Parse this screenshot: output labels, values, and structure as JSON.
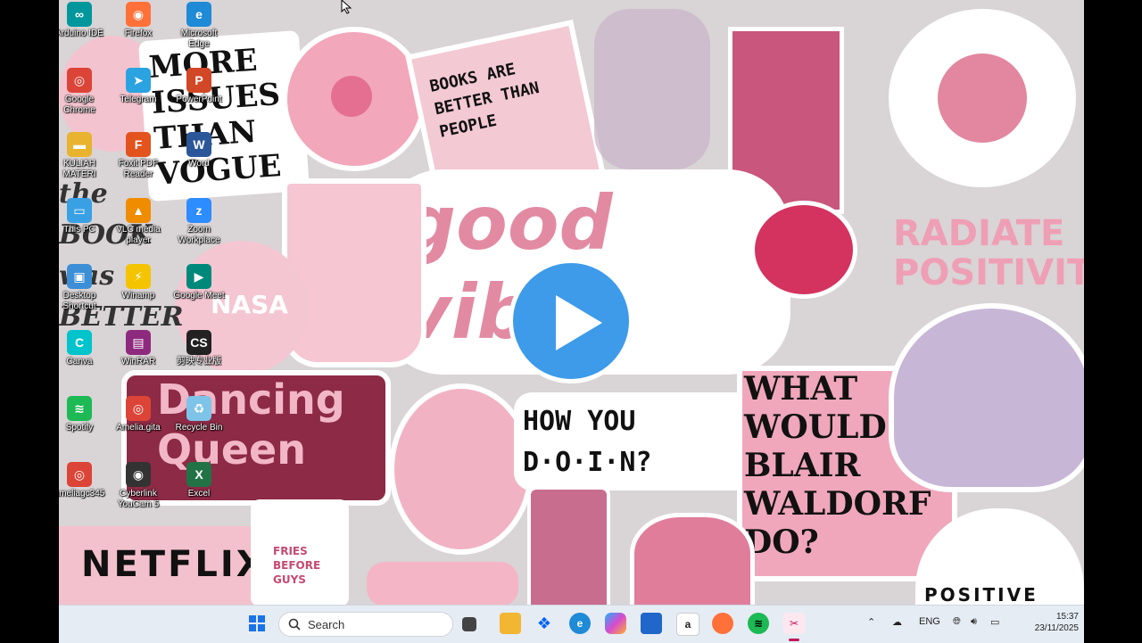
{
  "wallpaper": {
    "sticker_more_issues": "MORE ISSUES THAN VOGUE",
    "sticker_books": "BOOKS ARE BETTER THAN PEOPLE",
    "sticker_good_vibes": "good vibes",
    "sticker_radiate": "RADIATE POSITIVITY",
    "sticker_dancing": "Dancing Queen",
    "sticker_how_you_doin": "HOW YOU D·O·I·N?",
    "sticker_blair": "WHAT WOULD BLAIR WALDORF DO?",
    "sticker_netflix": "NETFLIX",
    "sticker_fries": "FRIES BEFORE GUYS",
    "sticker_positive": "POSITIVE",
    "sticker_nasa": "NASA",
    "sticker_left_words": "the BOOK was BETTER"
  },
  "desktop_icons": [
    {
      "label": "Arduino IDE",
      "color": "#00979c",
      "glyph": "∞"
    },
    {
      "label": "Firefox",
      "color": "#ff7139",
      "glyph": "◉"
    },
    {
      "label": "Microsoft Edge",
      "color": "#1f8ad6",
      "glyph": "e"
    },
    {
      "label": "Google Chrome",
      "color": "#db4437",
      "glyph": "◎"
    },
    {
      "label": "Telegram",
      "color": "#2aa3e0",
      "glyph": "➤"
    },
    {
      "label": "PowerPoint",
      "color": "#d24726",
      "glyph": "P"
    },
    {
      "label": "KULIAH MATERI",
      "color": "#e8b32e",
      "glyph": "▬"
    },
    {
      "label": "Foxit PDF Reader",
      "color": "#e2531e",
      "glyph": "F"
    },
    {
      "label": "Word",
      "color": "#2b579a",
      "glyph": "W"
    },
    {
      "label": "This PC",
      "color": "#3aa0e4",
      "glyph": "▭"
    },
    {
      "label": "VLC media player",
      "color": "#f08c00",
      "glyph": "▲"
    },
    {
      "label": "Zoom Workplace",
      "color": "#2d8cff",
      "glyph": "z"
    },
    {
      "label": "Desktop Shortcut",
      "color": "#3c8fd6",
      "glyph": "▣"
    },
    {
      "label": "Winamp",
      "color": "#f4c400",
      "glyph": "⚡"
    },
    {
      "label": "Google Meet",
      "color": "#00897b",
      "glyph": "▶"
    },
    {
      "label": "Canva",
      "color": "#00c4cc",
      "glyph": "C"
    },
    {
      "label": "WinRAR",
      "color": "#8e2a7e",
      "glyph": "▤"
    },
    {
      "label": "剪映专业版",
      "color": "#222222",
      "glyph": "CS"
    },
    {
      "label": "Spotify",
      "color": "#1db954",
      "glyph": "≋"
    },
    {
      "label": "Amelia.gita",
      "color": "#db4437",
      "glyph": "◎"
    },
    {
      "label": "Recycle Bin",
      "color": "#7ec3e8",
      "glyph": "♻"
    },
    {
      "label": "ameliagc345",
      "color": "#db4437",
      "glyph": "◎"
    },
    {
      "label": "Cyberlink YouCam 5",
      "color": "#333333",
      "glyph": "◉"
    },
    {
      "label": "Excel",
      "color": "#217346",
      "glyph": "X"
    }
  ],
  "taskbar": {
    "search_label": "Search",
    "language": "ENG",
    "time": "15:37",
    "date": "23/11/2025",
    "icons": [
      "windows-start-icon",
      "search-icon",
      "task-view-icon",
      "file-explorer-icon",
      "dropbox-icon",
      "edge-icon",
      "copilot-icon",
      "store-icon",
      "amazon-icon",
      "firefox-icon",
      "spotify-icon",
      "snipping-tool-icon"
    ]
  },
  "colors": {
    "play_button": "#3d9be9",
    "taskbar_bg": "#e6ecf4",
    "accent_pink": "#e58fa8"
  }
}
